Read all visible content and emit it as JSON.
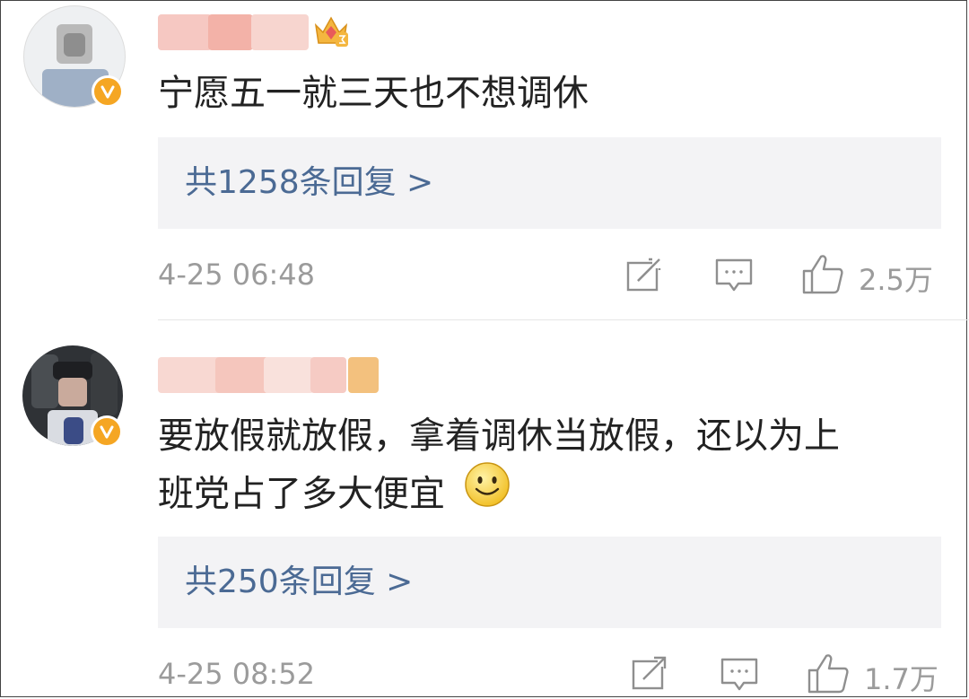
{
  "comments": [
    {
      "text_line1": "宁愿五一就三天也不想调休",
      "text_line2": "",
      "replies_label": "共1258条回复 >",
      "time": "4-25 06:48",
      "likes": "2.5万"
    },
    {
      "text_line1": "要放假就放假，拿着调休当放假，还以为上",
      "text_line2": "班党占了多大便宜",
      "replies_label": "共250条回复 >",
      "time": "4-25 08:52",
      "likes": "1.7万"
    }
  ],
  "icons": [
    "share-icon",
    "comment-icon",
    "like-icon",
    "verified-badge-icon",
    "crown-badge-icon",
    "smile-emoji-icon"
  ],
  "colors": {
    "link": "#4b6a94",
    "meta": "#9b9b9b",
    "badge": "#f5a623",
    "reply_bg": "#f3f3f5"
  }
}
